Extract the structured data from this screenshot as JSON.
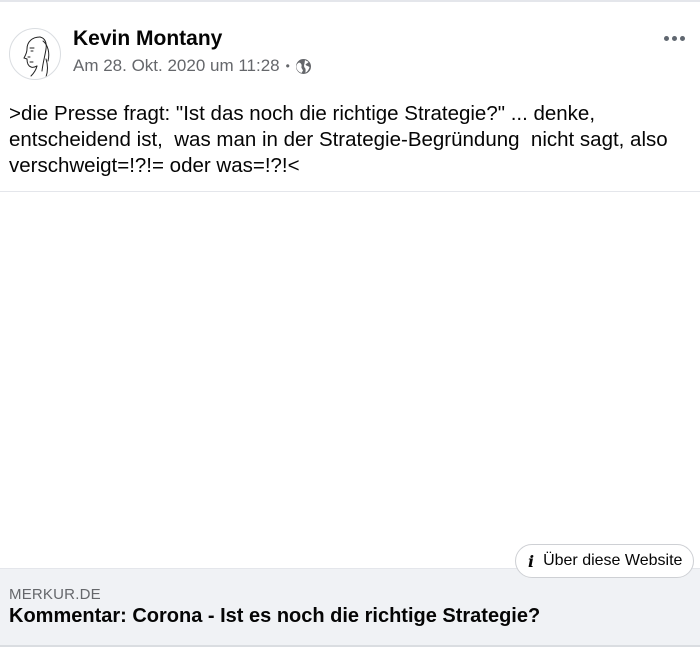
{
  "post": {
    "author": "Kevin Montany",
    "timestamp": "Am 28. Okt. 2020 um 11:28",
    "separator": "•",
    "audience_icon": "globe-icon",
    "text": ">die Presse fragt: \"Ist das noch die richtige Strategie?\" ... denke, entscheidend ist,  was man in der Strategie-Begründung  nicht sagt, also verschweigt=!?!= oder was=!?!<"
  },
  "link_preview": {
    "about_button_label": "Über diese Website",
    "about_icon": "info-icon",
    "domain": "MERKUR.DE",
    "title": "Kommentar: Corona - Ist es noch die richtige Strategie?"
  },
  "colors": {
    "text_primary": "#050505",
    "text_secondary": "#65676b",
    "link_box_bg": "#f0f2f5",
    "divider": "#e4e6eb"
  }
}
